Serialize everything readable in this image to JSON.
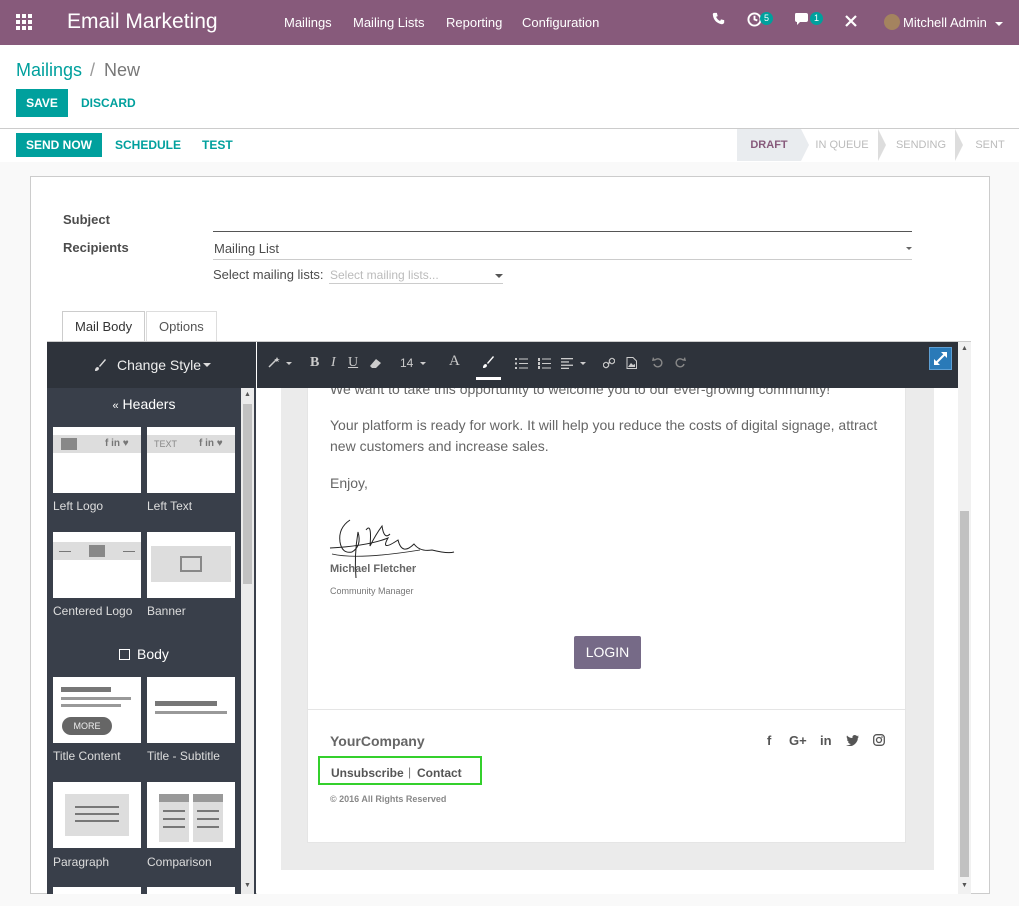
{
  "navbar": {
    "brand": "Email Marketing",
    "menu": [
      "Mailings",
      "Mailing Lists",
      "Reporting",
      "Configuration"
    ],
    "activity_count": "5",
    "messages_count": "1",
    "user": "Mitchell Admin"
  },
  "breadcrumb": {
    "parent": "Mailings",
    "separator": "/",
    "current": "New"
  },
  "actions": {
    "save": "Save",
    "discard": "Discard"
  },
  "statusbar_buttons": {
    "send_now": "Send Now",
    "schedule": "Schedule",
    "test": "Test"
  },
  "status_steps": [
    {
      "label": "Draft",
      "active": true
    },
    {
      "label": "In Queue",
      "active": false
    },
    {
      "label": "Sending",
      "active": false
    },
    {
      "label": "Sent",
      "active": false
    }
  ],
  "form": {
    "subject_label": "Subject",
    "subject_value": "",
    "recipients_label": "Recipients",
    "recipients_value": "Mailing List",
    "mailing_lists_label": "Select mailing lists:",
    "mailing_lists_placeholder": "Select mailing lists..."
  },
  "tabs": {
    "mail_body": "Mail Body",
    "options": "Options"
  },
  "editor": {
    "change_style": "Change Style",
    "font_size": "14",
    "snippets": {
      "headers_title": "Headers",
      "body_title": "Body",
      "items": [
        "Left Logo",
        "Left Text",
        "Centered Logo",
        "Banner",
        "Title Content",
        "Title - Subtitle",
        "Paragraph",
        "Comparison"
      ],
      "more_label": "MORE",
      "text_thumb": "TEXT"
    }
  },
  "mail": {
    "partial_line": "We want to take this opportunity to welcome you to our ever-growing community!",
    "para1_line1": "Your platform is ready for work. It will help you reduce the costs of digital signage, attract",
    "para1_line2": "new customers and increase sales.",
    "enjoy": "Enjoy,",
    "signer_name": "Michael Fletcher",
    "signer_title": "Community Manager",
    "login": "LOGIN",
    "company": "YourCompany",
    "unsubscribe": "Unsubscribe",
    "link_separator": "|",
    "contact": "Contact",
    "copyright": "© 2016 All Rights Reserved"
  },
  "colors": {
    "navbar": "#875A7B",
    "accent": "#00A09D",
    "highlight": "#34d02c",
    "login": "#766a87"
  }
}
